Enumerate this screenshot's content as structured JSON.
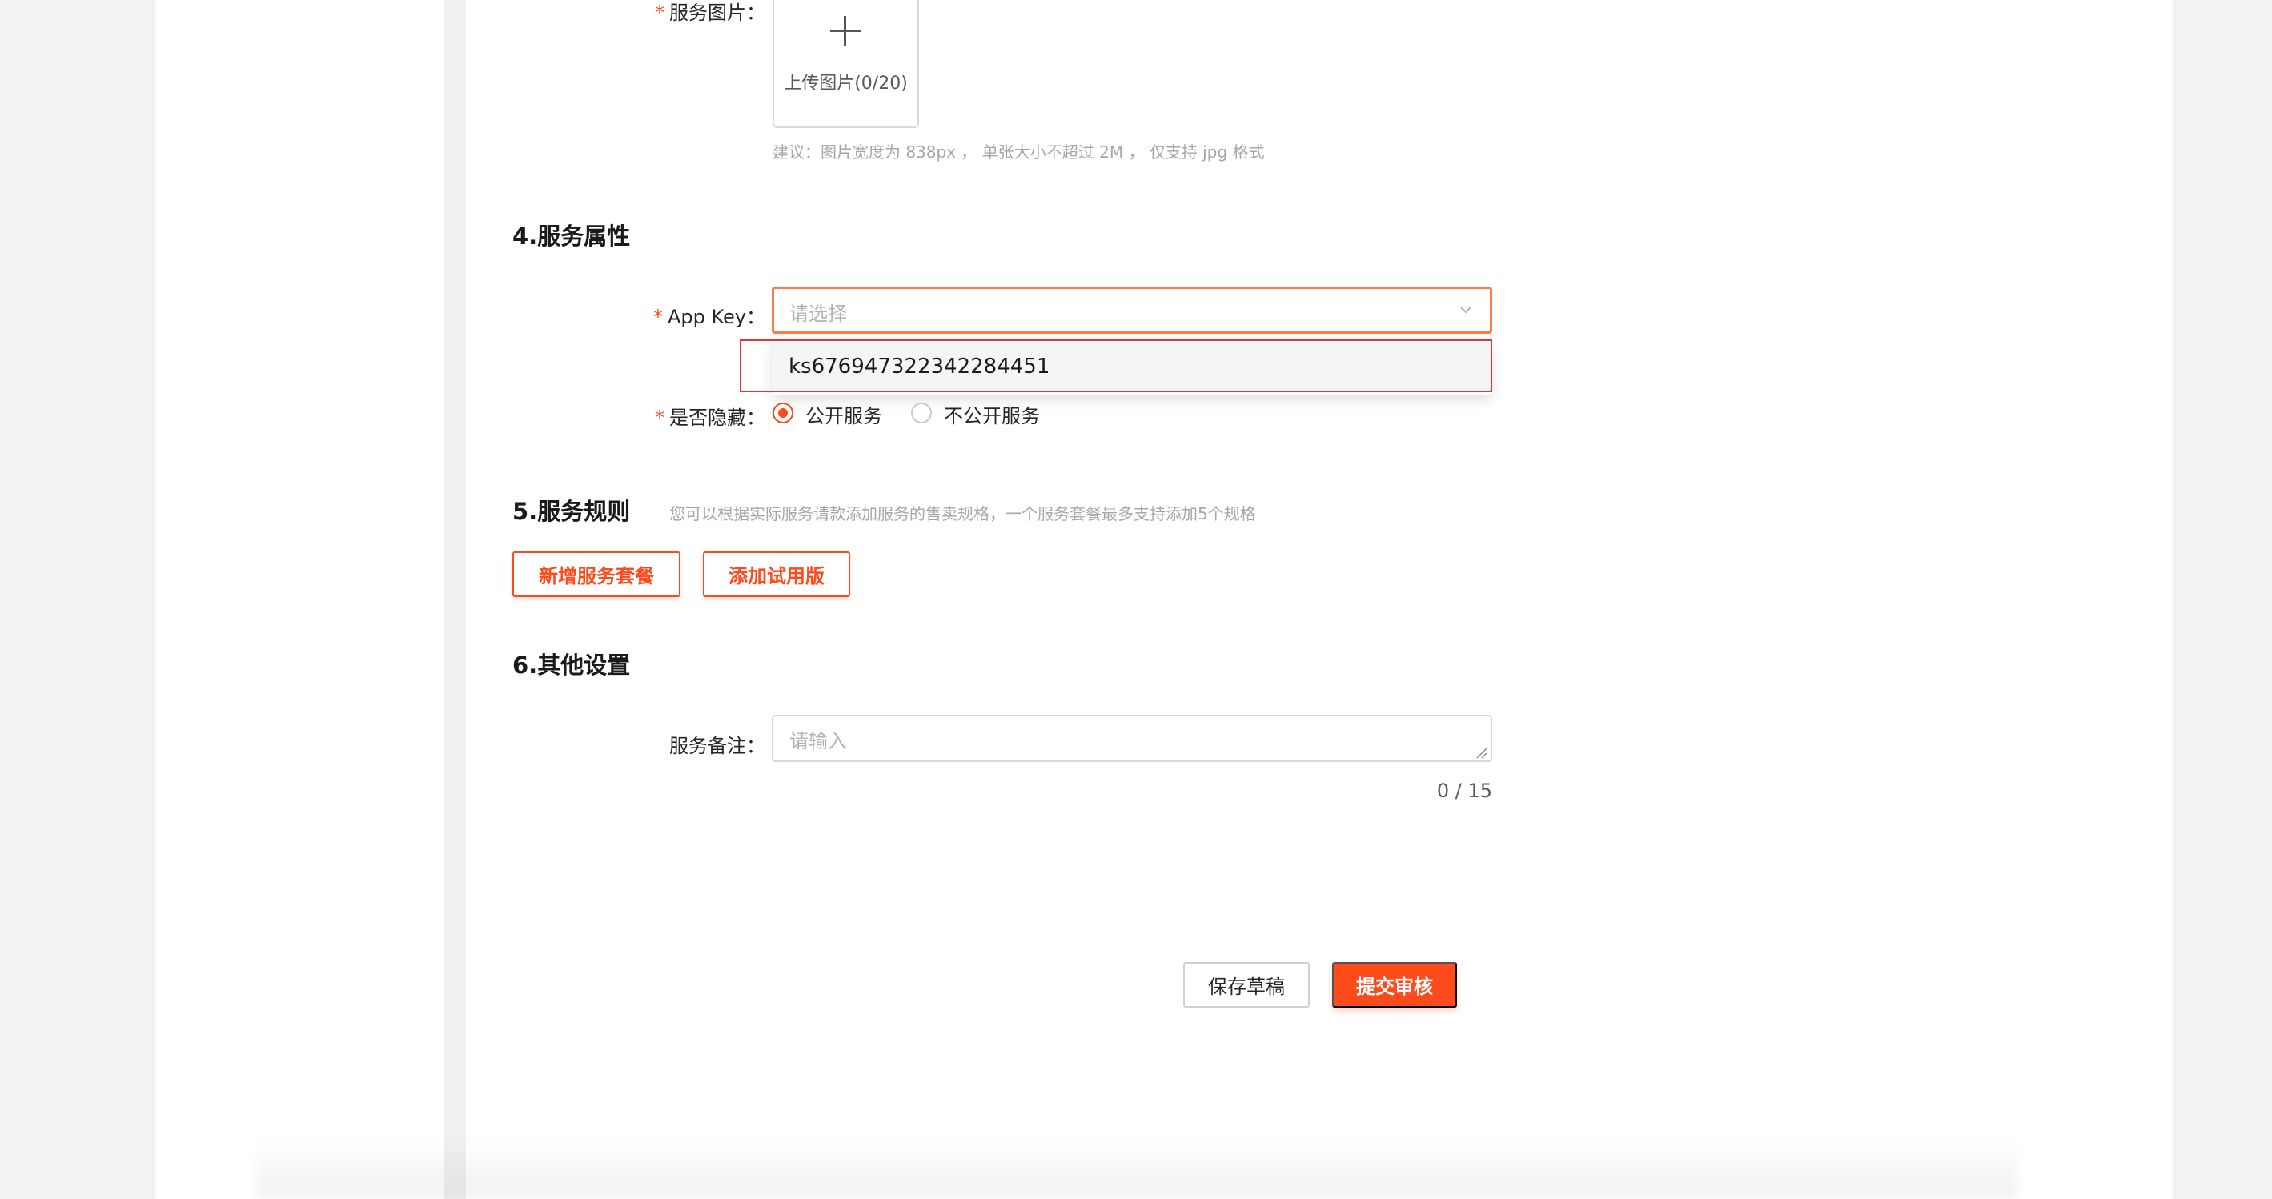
{
  "upload": {
    "label": "服务图片：",
    "required_mark": "*",
    "button_text": "上传图片(0/20)",
    "hint": "建议：图片宽度为 838px ， 单张大小不超过 2M ， 仅支持 jpg 格式"
  },
  "section4": {
    "title": "4.服务属性",
    "app_key": {
      "label": "App Key：",
      "required_mark": "*",
      "placeholder": "请选择",
      "options": [
        "ks676947322342284451"
      ]
    },
    "hidden": {
      "label": "是否隐藏：",
      "required_mark": "*",
      "options": [
        "公开服务",
        "不公开服务"
      ],
      "selected": "公开服务"
    }
  },
  "section5": {
    "title": "5.服务规则",
    "hint": "您可以根据实际服务请款添加服务的售卖规格，一个服务套餐最多支持添加5个规格",
    "add_package_label": "新增服务套餐",
    "add_trial_label": "添加试用版"
  },
  "section6": {
    "title": "6.其他设置",
    "remark": {
      "label": "服务备注：",
      "placeholder": "请输入",
      "counter": "0 / 15"
    }
  },
  "actions": {
    "save_draft_label": "保存草稿",
    "submit_label": "提交审核"
  },
  "colors": {
    "accent": "#ff4a1c",
    "focus_border": "#ff7a45",
    "highlight_frame": "#e8332f"
  }
}
